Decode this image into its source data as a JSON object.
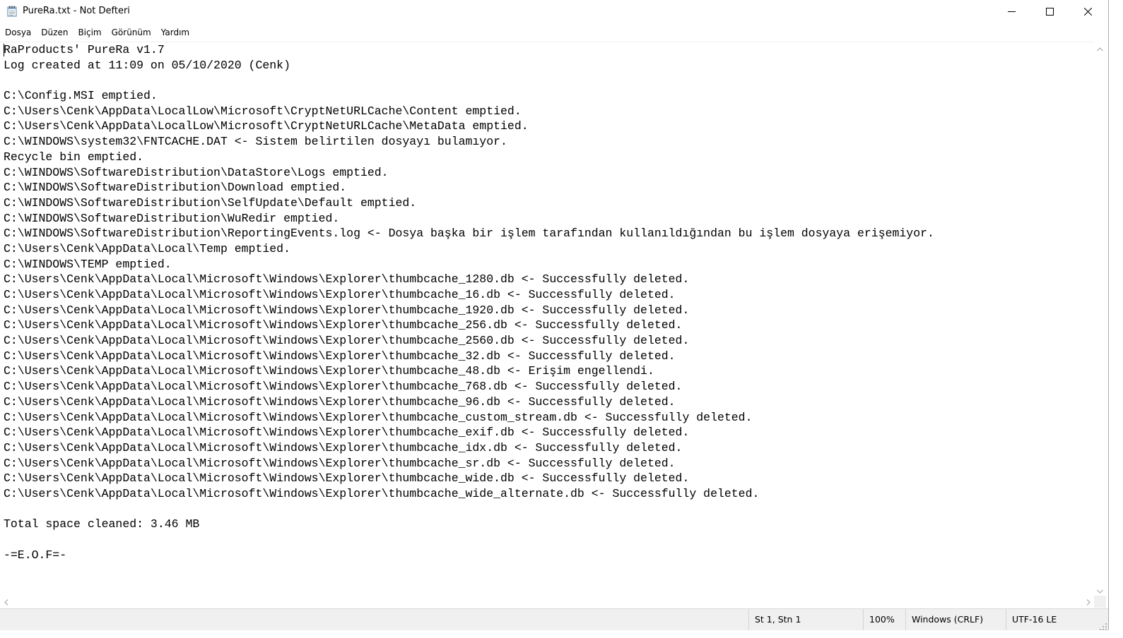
{
  "window": {
    "title": "PureRa.txt - Not Defteri"
  },
  "menu": {
    "items": [
      "Dosya",
      "Düzen",
      "Biçim",
      "Görünüm",
      "Yardım"
    ]
  },
  "document": {
    "lines": [
      "RaProducts' PureRa v1.7",
      "Log created at 11:09 on 05/10/2020 (Cenk)",
      "",
      "C:\\Config.MSI emptied.",
      "C:\\Users\\Cenk\\AppData\\LocalLow\\Microsoft\\CryptNetURLCache\\Content emptied.",
      "C:\\Users\\Cenk\\AppData\\LocalLow\\Microsoft\\CryptNetURLCache\\MetaData emptied.",
      "C:\\WINDOWS\\system32\\FNTCACHE.DAT <- Sistem belirtilen dosyayı bulamıyor.",
      "Recycle bin emptied.",
      "C:\\WINDOWS\\SoftwareDistribution\\DataStore\\Logs emptied.",
      "C:\\WINDOWS\\SoftwareDistribution\\Download emptied.",
      "C:\\WINDOWS\\SoftwareDistribution\\SelfUpdate\\Default emptied.",
      "C:\\WINDOWS\\SoftwareDistribution\\WuRedir emptied.",
      "C:\\WINDOWS\\SoftwareDistribution\\ReportingEvents.log <- Dosya başka bir işlem tarafından kullanıldığından bu işlem dosyaya erişemiyor.",
      "C:\\Users\\Cenk\\AppData\\Local\\Temp emptied.",
      "C:\\WINDOWS\\TEMP emptied.",
      "C:\\Users\\Cenk\\AppData\\Local\\Microsoft\\Windows\\Explorer\\thumbcache_1280.db <- Successfully deleted.",
      "C:\\Users\\Cenk\\AppData\\Local\\Microsoft\\Windows\\Explorer\\thumbcache_16.db <- Successfully deleted.",
      "C:\\Users\\Cenk\\AppData\\Local\\Microsoft\\Windows\\Explorer\\thumbcache_1920.db <- Successfully deleted.",
      "C:\\Users\\Cenk\\AppData\\Local\\Microsoft\\Windows\\Explorer\\thumbcache_256.db <- Successfully deleted.",
      "C:\\Users\\Cenk\\AppData\\Local\\Microsoft\\Windows\\Explorer\\thumbcache_2560.db <- Successfully deleted.",
      "C:\\Users\\Cenk\\AppData\\Local\\Microsoft\\Windows\\Explorer\\thumbcache_32.db <- Successfully deleted.",
      "C:\\Users\\Cenk\\AppData\\Local\\Microsoft\\Windows\\Explorer\\thumbcache_48.db <- Erişim engellendi.",
      "C:\\Users\\Cenk\\AppData\\Local\\Microsoft\\Windows\\Explorer\\thumbcache_768.db <- Successfully deleted.",
      "C:\\Users\\Cenk\\AppData\\Local\\Microsoft\\Windows\\Explorer\\thumbcache_96.db <- Successfully deleted.",
      "C:\\Users\\Cenk\\AppData\\Local\\Microsoft\\Windows\\Explorer\\thumbcache_custom_stream.db <- Successfully deleted.",
      "C:\\Users\\Cenk\\AppData\\Local\\Microsoft\\Windows\\Explorer\\thumbcache_exif.db <- Successfully deleted.",
      "C:\\Users\\Cenk\\AppData\\Local\\Microsoft\\Windows\\Explorer\\thumbcache_idx.db <- Successfully deleted.",
      "C:\\Users\\Cenk\\AppData\\Local\\Microsoft\\Windows\\Explorer\\thumbcache_sr.db <- Successfully deleted.",
      "C:\\Users\\Cenk\\AppData\\Local\\Microsoft\\Windows\\Explorer\\thumbcache_wide.db <- Successfully deleted.",
      "C:\\Users\\Cenk\\AppData\\Local\\Microsoft\\Windows\\Explorer\\thumbcache_wide_alternate.db <- Successfully deleted.",
      "",
      "Total space cleaned: 3.46 MB",
      "",
      "-=E.O.F=-"
    ]
  },
  "statusbar": {
    "position": "St 1, Stn 1",
    "zoom": "100%",
    "line_ending": "Windows (CRLF)",
    "encoding": "UTF-16 LE"
  },
  "icons": {
    "app": "notepad-icon",
    "minimize": "minimize-icon",
    "maximize": "maximize-icon",
    "close": "close-icon"
  }
}
